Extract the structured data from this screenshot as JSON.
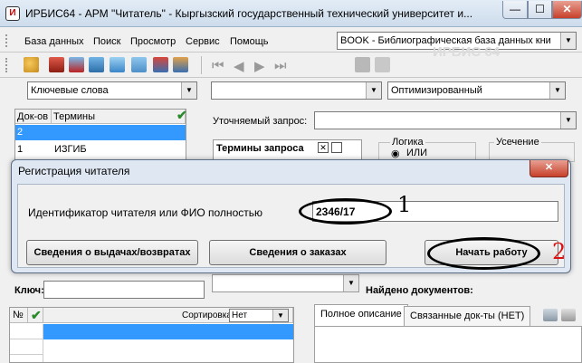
{
  "window": {
    "title": "ИРБИС64 - АРМ \"Читатель\" - Кыргызский государственный технический университет и...",
    "app_icon_text": "И",
    "minimize": "—",
    "maximize": "☐",
    "close": "✕"
  },
  "menu": {
    "items": [
      "База данных",
      "Поиск",
      "Просмотр",
      "Сервис",
      "Помощь"
    ],
    "database_select": "BOOK - Библиографическая база данных кни"
  },
  "background_watermark": "ИРБИС 64",
  "filters": {
    "search_type": "Ключевые слова",
    "second": "",
    "mode": "Оптимизированный"
  },
  "terms_grid": {
    "col_docs": "Док-ов",
    "col_terms": "Термины",
    "rows": [
      {
        "docs": "2",
        "term": ""
      },
      {
        "docs": "1",
        "term": "ИЗГИБ"
      }
    ]
  },
  "query": {
    "refine_label": "Уточняемый запрос:",
    "refine_value": "",
    "terms_header": "Термины запроса",
    "logic_label": "Логика",
    "logic_option": "ИЛИ",
    "truncation_label": "Усечение"
  },
  "lower": {
    "key_label": "Ключ:",
    "key_value": "",
    "found_label": "Найдено документов:",
    "col_num": "№",
    "sort_label": "Сортировка",
    "sort_value": "Нет",
    "tab_full": "Полное описание",
    "tab_linked": "Связанные док-ты (НЕТ)"
  },
  "dialog": {
    "title": "Регистрация читателя",
    "close": "✕",
    "label": "Идентификатор читателя или ФИО полностью",
    "input_value": "2346/17",
    "btn_loans": "Сведения о выдачах/возвратах",
    "btn_orders": "Сведения о заказах",
    "btn_start": "Начать работу"
  },
  "annotations": {
    "first": "1",
    "second": "2"
  },
  "colors": {
    "selection": "#3399ff",
    "close_red": "#c7412b",
    "check_green": "#2a8a2a",
    "annotation_red": "#d11"
  }
}
